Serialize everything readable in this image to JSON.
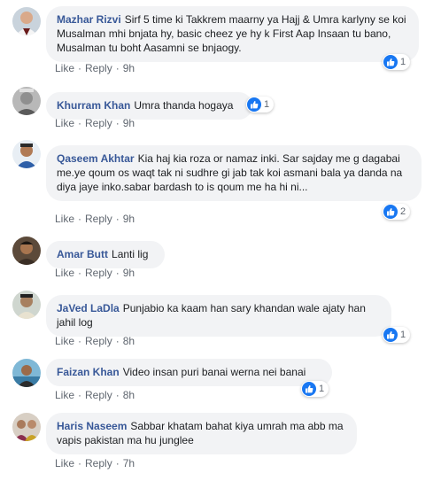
{
  "accent": "#385898",
  "like_color": "#1877f2",
  "comments": [
    {
      "author": "Mazhar Rizvi",
      "text": "Sirf 5 time ki Takkrem maarny ya Hajj & Umra karlyny se koi Musalman mhi bnjata hy, basic cheez ye hy k First Aap Insaan tu bano, Musalman tu boht Aasamni se bnjaogy.",
      "like": "Like",
      "reply": "Reply",
      "time": "9h",
      "reactions": "1"
    },
    {
      "author": "Khurram Khan",
      "text": "Umra thanda hogaya",
      "like": "Like",
      "reply": "Reply",
      "time": "9h",
      "reactions": "1"
    },
    {
      "author": "Qaseem Akhtar",
      "text": "Kia haj kia roza or namaz inki. Sar sajday me g dagabai me.ye qoum os waqt tak ni sudhre gi jab tak koi asmani bala ya danda na diya jaye inko.sabar bardash to is qoum me ha hi ni...",
      "like": "Like",
      "reply": "Reply",
      "time": "9h",
      "reactions": "2"
    },
    {
      "author": "Amar Butt",
      "text": "Lanti lig",
      "like": "Like",
      "reply": "Reply",
      "time": "9h",
      "reactions": ""
    },
    {
      "author": "JaVed LaDla",
      "text": "Punjabio ka kaam han sary khandan wale ajaty han jahil log",
      "like": "Like",
      "reply": "Reply",
      "time": "8h",
      "reactions": "1"
    },
    {
      "author": "Faizan Khan",
      "text": "Video insan puri banai werna nei banai",
      "like": "Like",
      "reply": "Reply",
      "time": "8h",
      "reactions": "1"
    },
    {
      "author": "Haris Naseem",
      "text": "Sabbar khatam bahat kiya umrah ma abb ma vapis pakistan ma hu junglee",
      "like": "Like",
      "reply": "Reply",
      "time": "7h",
      "reactions": ""
    }
  ]
}
